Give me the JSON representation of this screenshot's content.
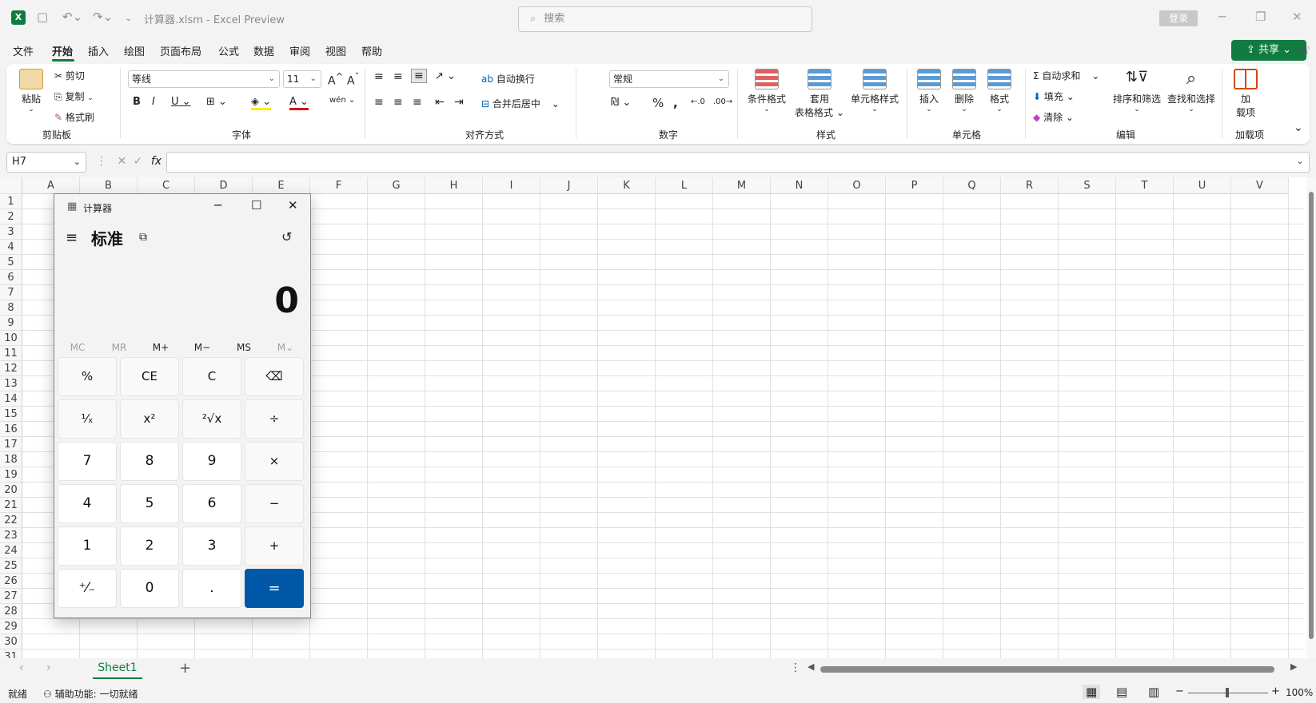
{
  "window": {
    "title": "计算器.xlsm  -  Excel Preview",
    "search_placeholder": "搜索",
    "login": "登录",
    "share": "共享"
  },
  "menu": [
    "文件",
    "开始",
    "插入",
    "绘图",
    "页面布局",
    "公式",
    "数据",
    "审阅",
    "视图",
    "帮助"
  ],
  "ribbon": {
    "clipboard": {
      "paste": "粘贴",
      "cut": "剪切",
      "copy": "复制",
      "format_painter": "格式刷",
      "label": "剪贴板"
    },
    "font": {
      "name": "等线",
      "size": "11",
      "label": "字体"
    },
    "alignment": {
      "wrap": "自动换行",
      "merge": "合并后居中",
      "label": "对齐方式"
    },
    "number": {
      "format": "常规",
      "label": "数字"
    },
    "styles": {
      "conditional": "条件格式",
      "table_line1": "套用",
      "table_line2": "表格格式",
      "cell_styles": "单元格样式",
      "label": "样式"
    },
    "cells": {
      "insert": "插入",
      "delete": "删除",
      "format": "格式",
      "label": "单元格"
    },
    "editing": {
      "autosum": "自动求和",
      "fill": "填充",
      "clear": "清除",
      "sort": "排序和筛选",
      "find": "查找和选择",
      "label": "编辑"
    },
    "addins": {
      "line1": "加",
      "line2": "载项",
      "label": "加载项"
    }
  },
  "formula_bar": {
    "name_box": "H7",
    "fx": "fx"
  },
  "columns": [
    "A",
    "B",
    "C",
    "D",
    "E",
    "F",
    "G",
    "H",
    "I",
    "J",
    "K",
    "L",
    "M",
    "N",
    "O",
    "P",
    "Q",
    "R",
    "S",
    "T",
    "U",
    "V"
  ],
  "rows": [
    "1",
    "2",
    "3",
    "4",
    "5",
    "6",
    "7",
    "8",
    "9",
    "10",
    "11",
    "12",
    "13",
    "14",
    "15",
    "16",
    "17",
    "18",
    "19",
    "20",
    "21",
    "22",
    "23",
    "24",
    "25",
    "26",
    "27",
    "28",
    "29",
    "30",
    "31"
  ],
  "sheet": {
    "tab": "Sheet1",
    "add": "+"
  },
  "status": {
    "ready": "就绪",
    "accessibility": "辅助功能: 一切就绪",
    "zoom": "100%"
  },
  "calculator": {
    "title": "计算器",
    "mode": "标准",
    "display": "0",
    "memory": [
      "MC",
      "MR",
      "M+",
      "M−",
      "MS",
      "M⌄"
    ],
    "keys": [
      "%",
      "CE",
      "C",
      "⌫",
      "¹⁄ₓ",
      "x²",
      "²√x",
      "÷",
      "7",
      "8",
      "9",
      "×",
      "4",
      "5",
      "6",
      "−",
      "1",
      "2",
      "3",
      "+",
      "⁺⁄₋",
      "0",
      ".",
      "="
    ]
  },
  "colors": {
    "excel_green": "#107c41",
    "calc_equals": "#0057a7"
  }
}
